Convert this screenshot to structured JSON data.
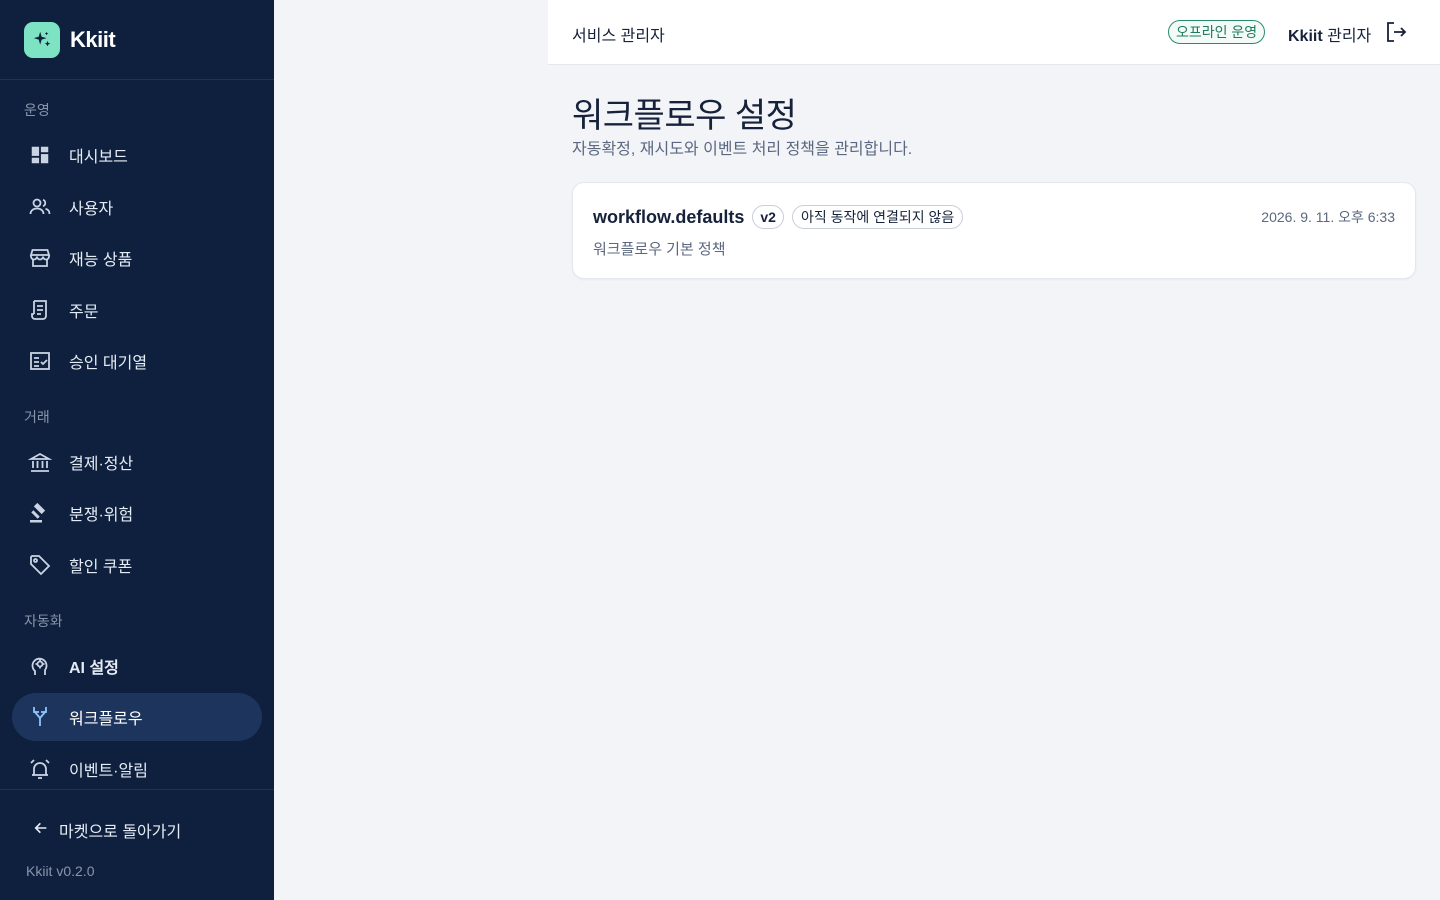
{
  "brand": {
    "name": "Kkiit"
  },
  "sidebar": {
    "sections": [
      {
        "title": "운영"
      },
      {
        "title": "거래"
      },
      {
        "title": "자동화"
      }
    ],
    "items": [
      {
        "label": "대시보드",
        "icon": "dashboard-icon"
      },
      {
        "label": "사용자",
        "icon": "users-icon"
      },
      {
        "label": "재능 상품",
        "icon": "storefront-icon"
      },
      {
        "label": "주문",
        "icon": "receipt-icon"
      },
      {
        "label": "승인 대기열",
        "icon": "checklist-icon"
      },
      {
        "label": "결제·정산",
        "icon": "bank-icon"
      },
      {
        "label": "분쟁·위험",
        "icon": "gavel-icon"
      },
      {
        "label": "할인 쿠폰",
        "icon": "tag-icon"
      },
      {
        "label": "AI 설정",
        "icon": "ai-head-icon"
      },
      {
        "label": "워크플로우",
        "icon": "workflow-icon",
        "active": true
      },
      {
        "label": "이벤트·알림",
        "icon": "alarm-icon"
      }
    ],
    "back_label": "마켓으로 돌아가기",
    "version": "Kkiit v0.2.0"
  },
  "header": {
    "title": "서비스 관리자",
    "status": "오프라인 운영",
    "user_bold": "Kkiit",
    "user_role": " 관리자"
  },
  "main": {
    "title": "워크플로우 설정",
    "subtitle": "자동확정, 재시도와 이벤트 처리 정책을 관리합니다.",
    "policy": {
      "key": "workflow.defaults",
      "version": "v2",
      "status": "아직 동작에 연결되지 않음",
      "date": "2026. 9. 11. 오후 6:33",
      "description": "워크플로우 기본 정책"
    }
  },
  "colors": {
    "sidebar_bg": "#0e203d",
    "active_bg": "#1d355d",
    "accent": "#7ee3c3",
    "status_green": "#227a5b"
  }
}
